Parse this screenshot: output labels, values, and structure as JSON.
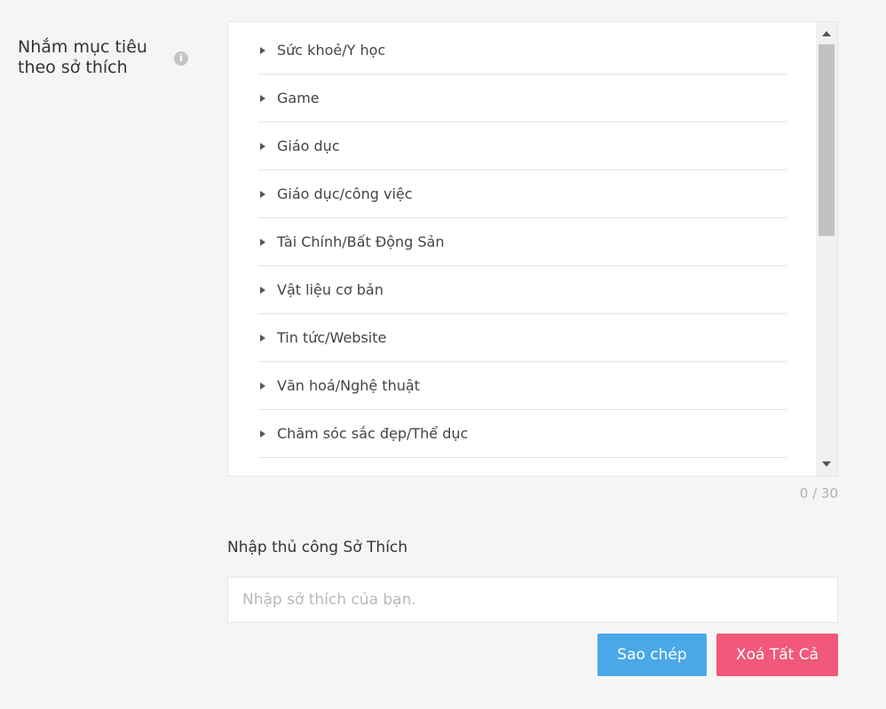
{
  "interest_field": {
    "label": "Nhắm mục tiêu theo sở thích",
    "info_icon": "info-icon",
    "categories": [
      "Sức khoẻ/Y học",
      "Game",
      "Giáo dục",
      "Giáo dục/công việc",
      "Tài Chính/Bất Động Sản",
      "Vật liệu cơ bản",
      "Tin tức/Website",
      "Văn hoá/Nghệ thuật",
      "Chăm sóc sắc đẹp/Thể dục"
    ],
    "counter": "0 / 30"
  },
  "manual_entry": {
    "label": "Nhập thủ công Sở Thích",
    "placeholder": "Nhập sở thích của bạn.",
    "value": ""
  },
  "actions": {
    "copy_label": "Sao chép",
    "clear_label": "Xoá Tất Cả"
  },
  "colors": {
    "copy_button": "#4aa8e8",
    "clear_button": "#f1587a",
    "background": "#f5f5f5"
  }
}
